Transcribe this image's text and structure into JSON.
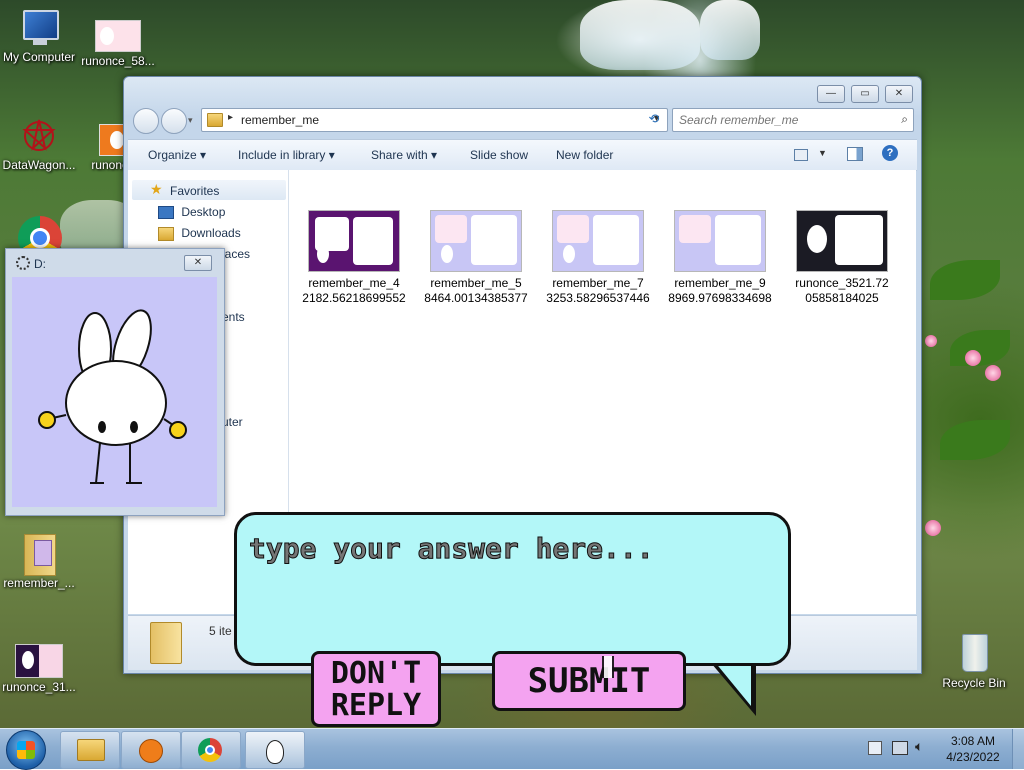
{
  "desktop": {
    "icons": [
      {
        "label": "My Computer",
        "name": "my-computer"
      },
      {
        "label": "runonce_58...",
        "name": "runonce-58"
      },
      {
        "label": "DataWagon...",
        "name": "datawagon"
      },
      {
        "label": "runonce...",
        "name": "runonce"
      },
      {
        "label": "remember_...",
        "name": "remember-folder"
      },
      {
        "label": "runonce_31...",
        "name": "runonce-31"
      },
      {
        "label": "Recycle Bin",
        "name": "recycle-bin"
      }
    ]
  },
  "explorer": {
    "path": "remember_me",
    "search_placeholder": "Search remember_me",
    "toolbar": {
      "organize": "Organize",
      "include": "Include in library",
      "share": "Share with",
      "slideshow": "Slide show",
      "newfolder": "New folder"
    },
    "nav": {
      "favorites": "Favorites",
      "desktop": "Desktop",
      "downloads": "Downloads",
      "places_partial": "laces",
      "ents_partial": "ents",
      "uter_partial": "uter"
    },
    "files": [
      {
        "line1": "remember_me_4",
        "line2": "2182.56218699552"
      },
      {
        "line1": "remember_me_5",
        "line2": "8464.00134385377"
      },
      {
        "line1": "remember_me_7",
        "line2": "3253.58296537446"
      },
      {
        "line1": "remember_me_9",
        "line2": "8969.97698334698"
      },
      {
        "line1": "runonce_3521.72",
        "line2": "05858184025"
      }
    ],
    "status": "5 ite"
  },
  "small_window": {
    "title": "D:"
  },
  "bubble": {
    "placeholder": "type your answer here...",
    "dont_reply": [
      "DON'T",
      "REPLY"
    ],
    "submit": "SUBMIT"
  },
  "clock": {
    "time": "3:08 AM",
    "date": "4/23/2022"
  },
  "colors": {
    "bubble": "#b3f7f8",
    "button": "#f4a3f0",
    "thumb_purple": "#5a1470",
    "thumb_lavender": "#c8c6f5"
  }
}
